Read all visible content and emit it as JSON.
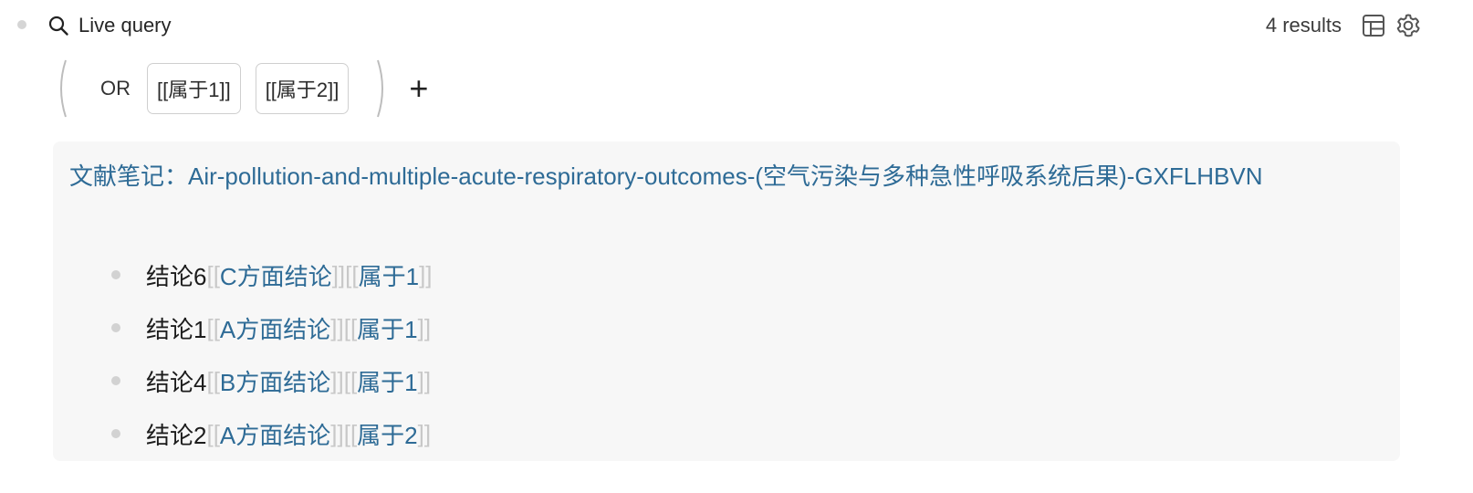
{
  "query": {
    "title": "Live query",
    "results_label": "4 results",
    "icons": {
      "search": "search-icon",
      "table": "table-icon",
      "settings": "gear-icon"
    }
  },
  "filter": {
    "operator": "OR",
    "chips": [
      "[[属于1]]",
      "[[属于2]]"
    ],
    "add_label": "+"
  },
  "result": {
    "page_title": "文献笔记：Air-pollution-and-multiple-acute-respiratory-outcomes-(空气污染与多种急性呼吸系统后果)-GXFLHBVN",
    "blocks": [
      {
        "text": "结论6",
        "ref1": "C方面结论",
        "ref2": "属于1"
      },
      {
        "text": "结论1",
        "ref1": "A方面结论",
        "ref2": "属于1"
      },
      {
        "text": "结论4",
        "ref1": "B方面结论",
        "ref2": "属于1"
      },
      {
        "text": "结论2",
        "ref1": "A方面结论",
        "ref2": "属于2"
      }
    ],
    "brackets": {
      "open": "[[",
      "close": "]]"
    }
  },
  "colors": {
    "link": "#2e6b96",
    "bracket": "#c8c8c8",
    "panel_bg": "#f7f7f7"
  }
}
